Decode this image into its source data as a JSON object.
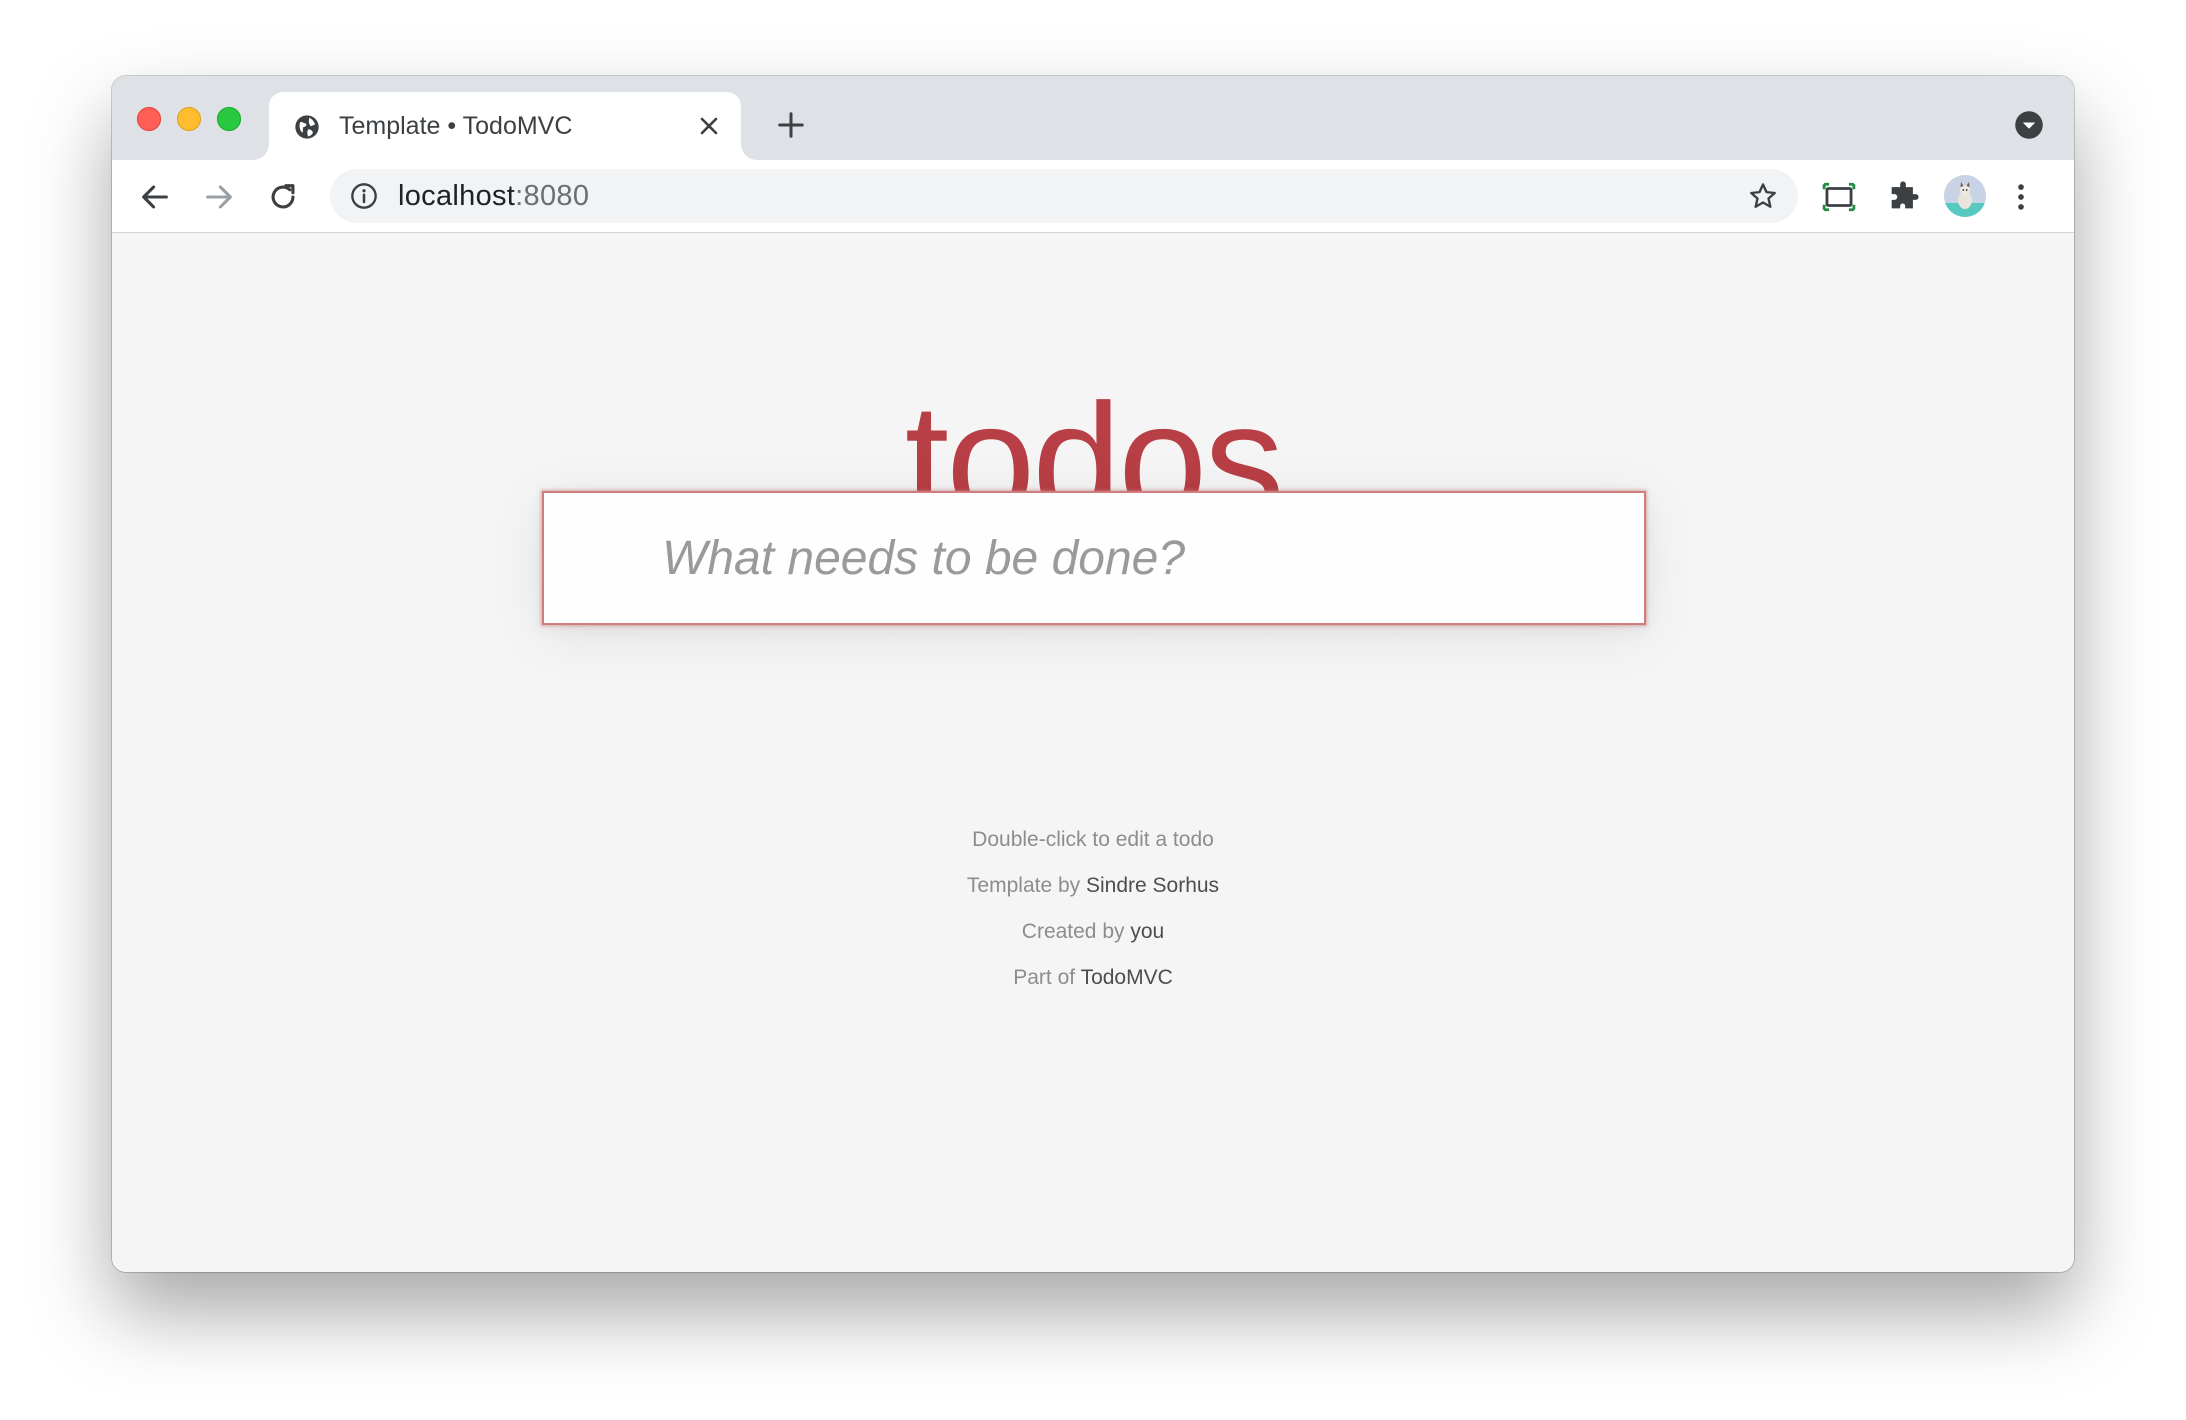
{
  "browser": {
    "tab": {
      "title": "Template • TodoMVC",
      "favicon": "globe-icon"
    },
    "omnibox": {
      "host": "localhost",
      "port": ":8080"
    },
    "icons": {
      "back": "arrow-left-icon",
      "forward": "arrow-right-icon",
      "reload": "reload-icon",
      "bookmark": "star-icon",
      "screencast": "screencast-icon",
      "extensions": "puzzle-icon",
      "menu": "kebab-icon",
      "tab_search": "chevron-down-icon"
    }
  },
  "app": {
    "title": "todos",
    "title_color": "#b83f45",
    "new_todo_placeholder": "What needs to be done?"
  },
  "info": {
    "hint": "Double-click to edit a todo",
    "template_prefix": "Template by ",
    "template_author": "Sindre Sorhus",
    "created_prefix": "Created by ",
    "created_author": "you",
    "part_prefix": "Part of ",
    "part_link": "TodoMVC"
  }
}
